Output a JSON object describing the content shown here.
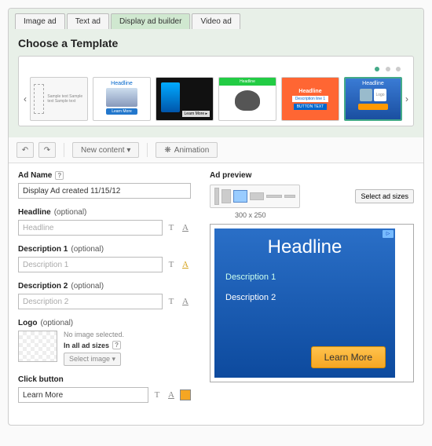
{
  "tabs": {
    "image": "Image ad",
    "text": "Text ad",
    "display": "Display ad builder",
    "video": "Video ad"
  },
  "templates": {
    "title": "Choose a Template",
    "thumbs": {
      "t1_lines": "Sample text\nSample text\nSample text",
      "t2_hd": "Headline",
      "t2_btn": "Learn More",
      "t3_btn": "Learn More ▸",
      "t4_bar": "Headline",
      "t5_hd": "Headline",
      "t5_desc": "Description line 1",
      "t5_btn": "BUTTON TEXT",
      "t6_hd": "Headline",
      "t6_logo": "Logo"
    }
  },
  "toolbar": {
    "newcontent": "New content ▾",
    "animation": "Animation"
  },
  "form": {
    "adname": {
      "label": "Ad Name",
      "value": "Display Ad created 11/15/12"
    },
    "headline": {
      "label": "Headline",
      "optional": "(optional)",
      "placeholder": "Headline"
    },
    "desc1": {
      "label": "Description 1",
      "optional": "(optional)",
      "placeholder": "Description 1"
    },
    "desc2": {
      "label": "Description 2",
      "optional": "(optional)",
      "placeholder": "Description 2"
    },
    "logo": {
      "label": "Logo",
      "optional": "(optional)",
      "noimg": "No image selected.",
      "allsizes": "In all ad sizes",
      "select": "Select image ▾"
    },
    "click": {
      "label": "Click button",
      "value": "Learn More",
      "color": "#f5a623"
    }
  },
  "preview": {
    "title": "Ad preview",
    "selectsizes": "Select ad sizes",
    "currentsize": "300 x 250",
    "ad": {
      "headline": "Headline",
      "d1": "Description 1",
      "d2": "Description 2",
      "cta": "Learn More"
    }
  }
}
